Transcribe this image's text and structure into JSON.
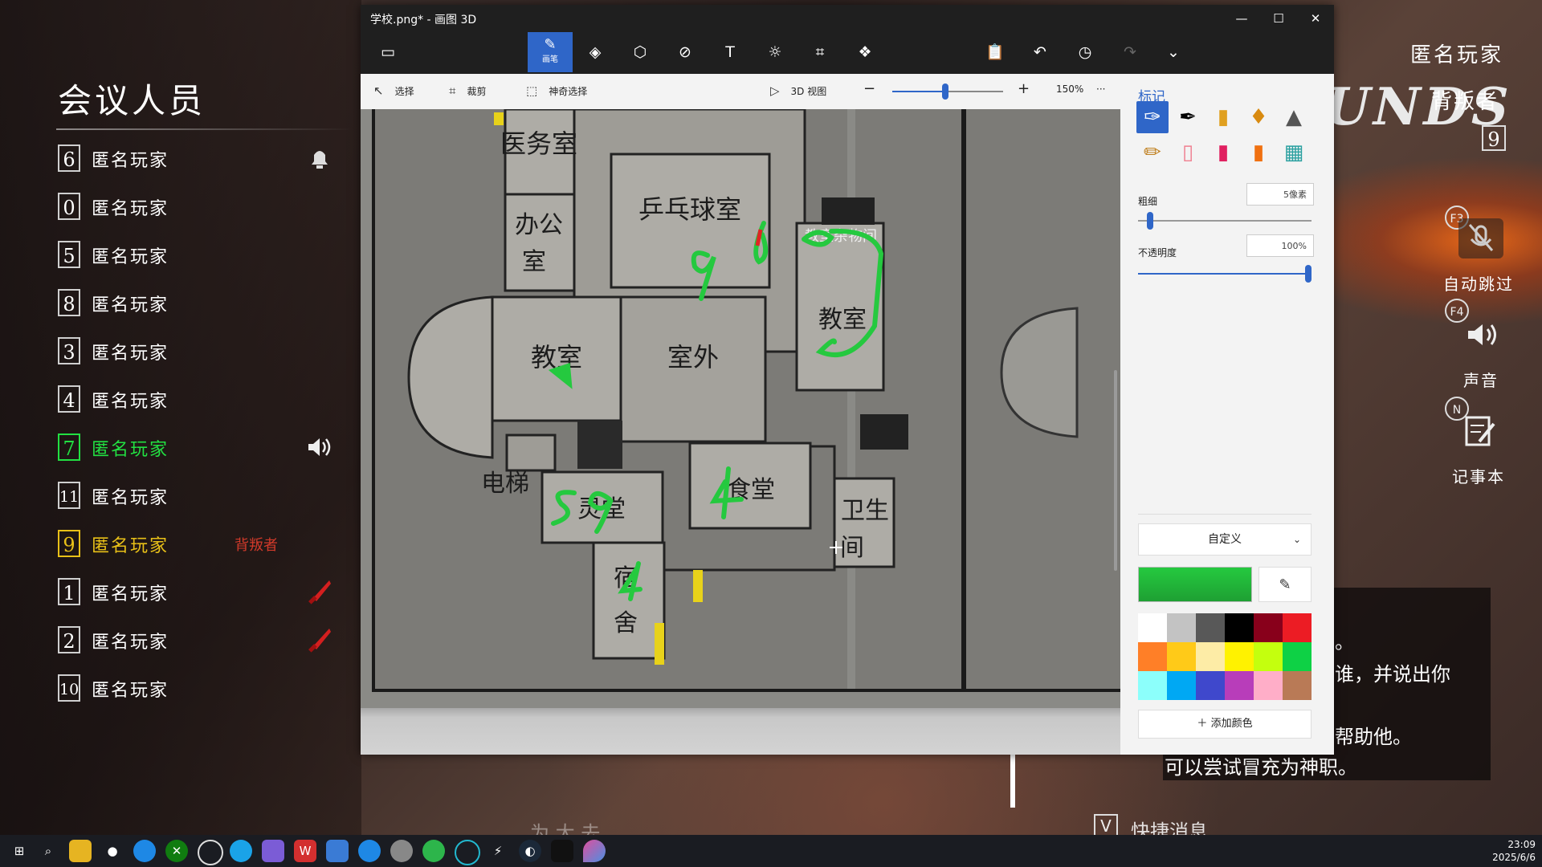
{
  "game": {
    "meeting_title": "会议人员",
    "players": [
      {
        "num": "6",
        "name": "匿名玩家",
        "tag": "",
        "icon": "alarm-bell-icon",
        "style": "normal"
      },
      {
        "num": "0",
        "name": "匿名玩家",
        "tag": "",
        "icon": "",
        "style": "normal"
      },
      {
        "num": "5",
        "name": "匿名玩家",
        "tag": "",
        "icon": "",
        "style": "normal"
      },
      {
        "num": "8",
        "name": "匿名玩家",
        "tag": "",
        "icon": "",
        "style": "normal"
      },
      {
        "num": "3",
        "name": "匿名玩家",
        "tag": "",
        "icon": "",
        "style": "normal"
      },
      {
        "num": "4",
        "name": "匿名玩家",
        "tag": "",
        "icon": "",
        "style": "normal"
      },
      {
        "num": "7",
        "name": "匿名玩家",
        "tag": "",
        "icon": "speaker-icon",
        "style": "green"
      },
      {
        "num": "11",
        "name": "匿名玩家",
        "tag": "",
        "icon": "",
        "style": "normal"
      },
      {
        "num": "9",
        "name": "匿名玩家",
        "tag": "背叛者",
        "icon": "",
        "style": "yellow"
      },
      {
        "num": "1",
        "name": "匿名玩家",
        "tag": "",
        "icon": "knife-icon",
        "style": "normal"
      },
      {
        "num": "2",
        "name": "匿名玩家",
        "tag": "",
        "icon": "knife-icon",
        "style": "normal"
      },
      {
        "num": "10",
        "name": "匿名玩家",
        "tag": "",
        "icon": "",
        "style": "normal"
      }
    ],
    "hud": {
      "self_name": "匿名玩家",
      "role": "背叛者",
      "self_num": "9",
      "brand_partial": "UNDS",
      "auto_skip_key": "F3",
      "auto_skip_label": "自动跳过",
      "sound_key": "F4",
      "sound_label": "声音",
      "notepad_key": "N",
      "notepad_label": "记事本"
    },
    "chat": {
      "line1": "。",
      "line2": "谁，并说出你",
      "line3": "帮助他。",
      "line4": "可以尝试冒充为神职。"
    },
    "quick_key": "V",
    "quick_label": "快捷消息",
    "bottom_ghost": "为 大 去"
  },
  "paint3d": {
    "window_title": "学校.png* - 画图 3D",
    "window_controls": {
      "minimize": "—",
      "maximize": "☐",
      "close": "✕"
    },
    "tools": {
      "brushes_label": "画笔"
    },
    "subbar": {
      "select": "选择",
      "crop": "裁剪",
      "magic_select": "神奇选择",
      "view3d": "3D 视图",
      "zoom": "150%",
      "more": "···"
    },
    "zoom_level_percent": 150,
    "map_labels": {
      "infirmary": "医务室",
      "office_a": "办公",
      "office_b": "室",
      "pingpong": "乒乓球室",
      "storage": "教室杂物间",
      "classroom_left": "教室",
      "outdoor": "室外",
      "classroom_right": "教室",
      "elevator": "电梯",
      "spirit_hall": "灵堂",
      "hall": "食堂",
      "restroom_a": "卫生",
      "restroom_b": "间",
      "dorm_a": "宿",
      "dorm_b": "舍"
    },
    "panel": {
      "title": "标记",
      "thickness_label": "粗细",
      "thickness_value": "5像素",
      "opacity_label": "不透明度",
      "opacity_value": "100%",
      "thickness_fraction": 0.04,
      "opacity_fraction": 1.0,
      "palette_mode": "自定义",
      "current_color": "#25c93f",
      "add_color": "添加颜色",
      "swatches": [
        "#ffffff",
        "#c3c3c3",
        "#585858",
        "#000000",
        "#88001b",
        "#ec1c24",
        "#ff7f27",
        "#ffca18",
        "#fdeca6",
        "#fff200",
        "#c4ff0e",
        "#0ed145",
        "#8cfffb",
        "#00a8f3",
        "#3f48cc",
        "#b83dba",
        "#ffaec8",
        "#b97a56"
      ]
    }
  },
  "taskbar": {
    "time": "23:09",
    "date": "2025/6/6"
  }
}
